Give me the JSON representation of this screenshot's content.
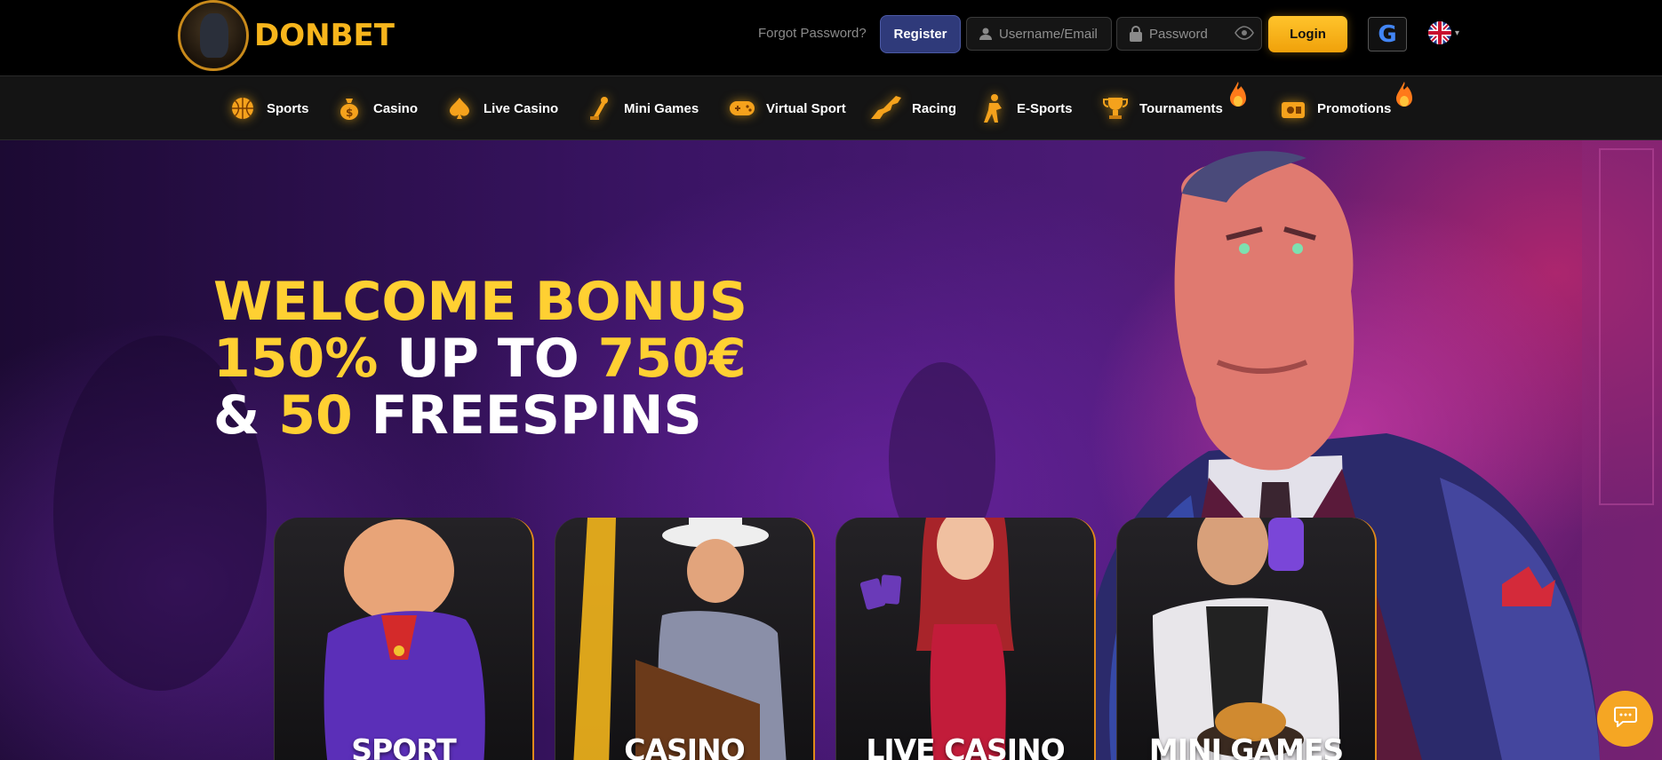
{
  "brand": {
    "name": "DONBET"
  },
  "header": {
    "forgot_password": "Forgot Password?",
    "register_label": "Register",
    "username_placeholder": "Username/Email",
    "password_placeholder": "Password",
    "login_label": "Login",
    "google_label": "G"
  },
  "nav": {
    "items": [
      {
        "label": "Sports",
        "icon": "basketball-icon"
      },
      {
        "label": "Casino",
        "icon": "money-bag-icon"
      },
      {
        "label": "Live Casino",
        "icon": "spade-icon"
      },
      {
        "label": "Mini Games",
        "icon": "joystick-icon"
      },
      {
        "label": "Virtual Sport",
        "icon": "gamepad-icon"
      },
      {
        "label": "Racing",
        "icon": "horse-icon"
      },
      {
        "label": "E-Sports",
        "icon": "soldier-icon"
      },
      {
        "label": "Tournaments",
        "icon": "trophy-icon"
      },
      {
        "label": "Promotions",
        "icon": "gift-icon"
      }
    ]
  },
  "hero": {
    "line1": "WELCOME BONUS",
    "line2_a": "150%",
    "line2_b": " UP TO ",
    "line2_c": "750€",
    "line3_a": "& ",
    "line3_b": "50",
    "line3_c": " FREESPINS"
  },
  "categories": [
    {
      "label": "SPORT"
    },
    {
      "label": "CASINO"
    },
    {
      "label": "LIVE CASINO"
    },
    {
      "label": "MINI GAMES"
    }
  ],
  "colors": {
    "accent_gold": "#ffd032",
    "register_bg": "#2f3a7a",
    "login_bg": "#f5b31c",
    "chat_bg": "#f5a623"
  }
}
